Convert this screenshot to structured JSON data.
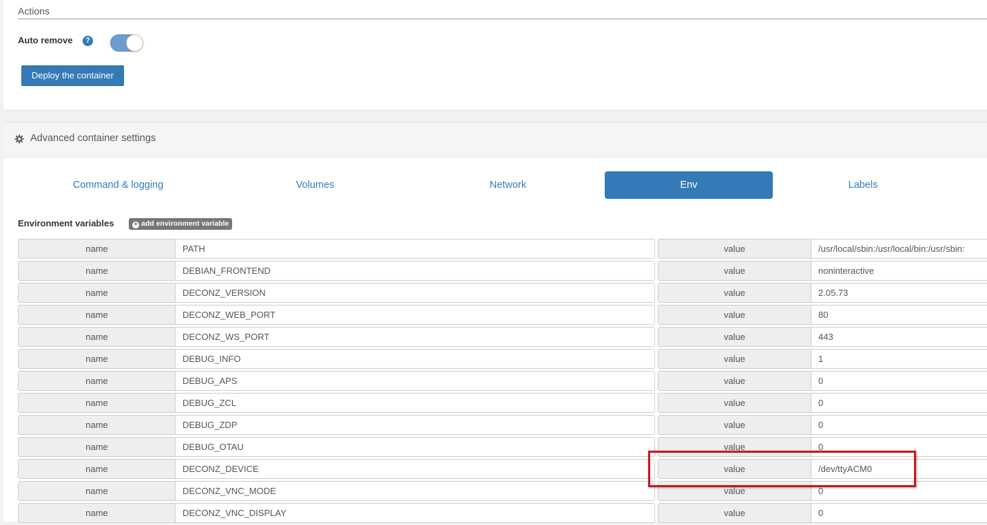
{
  "actions": {
    "title": "Actions",
    "auto_remove_label": "Auto remove",
    "help_icon": "?",
    "auto_remove_enabled": true,
    "deploy_label": "Deploy the container"
  },
  "advanced": {
    "title": "Advanced container settings",
    "icon": "gear-icon",
    "tabs": [
      {
        "label": "Command & logging",
        "active": false
      },
      {
        "label": "Volumes",
        "active": false
      },
      {
        "label": "Network",
        "active": false
      },
      {
        "label": "Env",
        "active": true
      },
      {
        "label": "Labels",
        "active": false
      }
    ]
  },
  "env": {
    "title": "Environment variables",
    "add_label": "add environment variable",
    "name_addon": "name",
    "value_addon": "value",
    "vars": [
      {
        "name": "PATH",
        "value": "/usr/local/sbin:/usr/local/bin:/usr/sbin:"
      },
      {
        "name": "DEBIAN_FRONTEND",
        "value": "noninteractive"
      },
      {
        "name": "DECONZ_VERSION",
        "value": "2.05.73"
      },
      {
        "name": "DECONZ_WEB_PORT",
        "value": "80"
      },
      {
        "name": "DECONZ_WS_PORT",
        "value": "443"
      },
      {
        "name": "DEBUG_INFO",
        "value": "1"
      },
      {
        "name": "DEBUG_APS",
        "value": "0"
      },
      {
        "name": "DEBUG_ZCL",
        "value": "0"
      },
      {
        "name": "DEBUG_ZDP",
        "value": "0"
      },
      {
        "name": "DEBUG_OTAU",
        "value": "0"
      },
      {
        "name": "DECONZ_DEVICE",
        "value": "/dev/ttyACM0"
      },
      {
        "name": "DECONZ_VNC_MODE",
        "value": "0"
      },
      {
        "name": "DECONZ_VNC_DISPLAY",
        "value": "0"
      }
    ]
  },
  "colors": {
    "primary": "#337ab7",
    "highlight": "#c8161d",
    "addon_bg": "#eeeeee"
  }
}
